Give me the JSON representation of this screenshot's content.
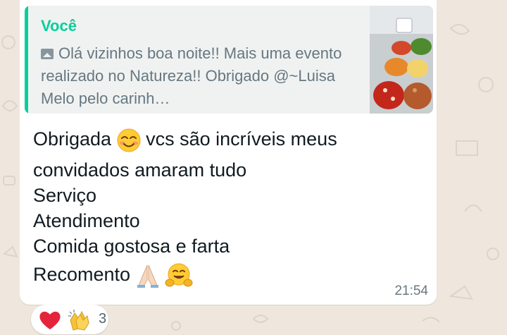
{
  "quoted_message": {
    "author": "Você",
    "text": "Olá vizinhos boa noite!! Mais uma evento realizado no Natureza!! Obrigado @~Luisa Melo pelo carinh…",
    "media_icon": "photo-icon",
    "thumbnail": "food-buffet-photo"
  },
  "message": {
    "line1_before_emoji": "Obrigada",
    "line1_emoji": "smiling-face-with-smiling-eyes",
    "line1_after_emoji": "vcs são incríveis meus",
    "line2": "convidados amaram tudo",
    "line3": "Serviço",
    "line4": "Atendimento",
    "line5": "Comida gostosa e farta",
    "line6": "Recomento",
    "line6_emojis": [
      "folded-hands",
      "hugging-face"
    ],
    "time": "21:54"
  },
  "reactions": {
    "emojis": [
      "red-heart",
      "clapping-hands"
    ],
    "count": "3"
  },
  "colors": {
    "wallpaper": "#efe7dd",
    "bubble": "#ffffff",
    "quote_background": "#f0f2f1",
    "quote_accent": "#06cf9c",
    "secondary_text": "#667781",
    "primary_text": "#111b21"
  }
}
